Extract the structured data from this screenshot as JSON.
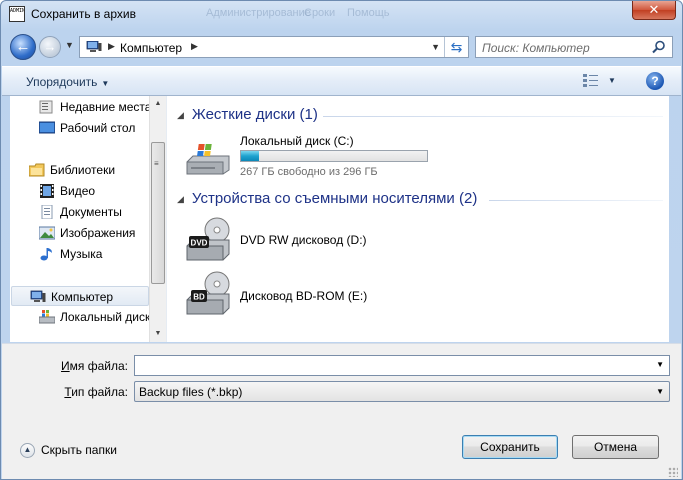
{
  "window": {
    "title": "Сохранить в архив",
    "app_icon_text": "ADMIN",
    "close_glyph": "✕",
    "ghost_menu": [
      "Администрирование",
      "Сроки",
      "Помощь"
    ]
  },
  "address_bar": {
    "breadcrumb": "Компьютер",
    "search_placeholder": "Поиск: Компьютер"
  },
  "toolbar": {
    "organize_label": "Упорядочить",
    "help_glyph": "?"
  },
  "nav_pane": {
    "items": [
      {
        "label": "Недавние места",
        "icon": "recent-places-icon"
      },
      {
        "label": "Рабочий стол",
        "icon": "desktop-icon"
      },
      {
        "label": "Библиотеки",
        "icon": "libraries-icon"
      },
      {
        "label": "Видео",
        "icon": "video-icon"
      },
      {
        "label": "Документы",
        "icon": "documents-icon"
      },
      {
        "label": "Изображения",
        "icon": "pictures-icon"
      },
      {
        "label": "Музыка",
        "icon": "music-icon"
      },
      {
        "label": "Компьютер",
        "icon": "computer-icon",
        "selected": true
      },
      {
        "label": "Локальный диск",
        "icon": "local-disk-icon"
      }
    ]
  },
  "content": {
    "groups": [
      {
        "header": "Жесткие диски (1)",
        "items": [
          {
            "name": "Локальный диск (C:)",
            "free_text": "267 ГБ свободно из 296 ГБ",
            "used_fraction": 0.098,
            "icon": "hard-disk-icon"
          }
        ]
      },
      {
        "header": "Устройства со съемными носителями (2)",
        "items": [
          {
            "name": "DVD RW дисковод (D:)",
            "icon": "dvd-drive-icon",
            "badge": "DVD"
          },
          {
            "name": "Дисковод BD-ROM (E:)",
            "icon": "bd-drive-icon",
            "badge": "BD"
          }
        ]
      }
    ]
  },
  "form": {
    "filename_label_accel": "И",
    "filename_label_rest": "мя файла:",
    "filename_value": "",
    "filetype_label_accel": "Т",
    "filetype_label_rest": "ип файла:",
    "filetype_value": "Backup files (*.bkp)",
    "hide_folders_label": "Скрыть папки",
    "save_label": "Сохранить",
    "cancel_label": "Отмена"
  },
  "colors": {
    "accent": "#1e3287",
    "usage_fill": "#1fa3cf",
    "close_button": "#c13f22"
  }
}
